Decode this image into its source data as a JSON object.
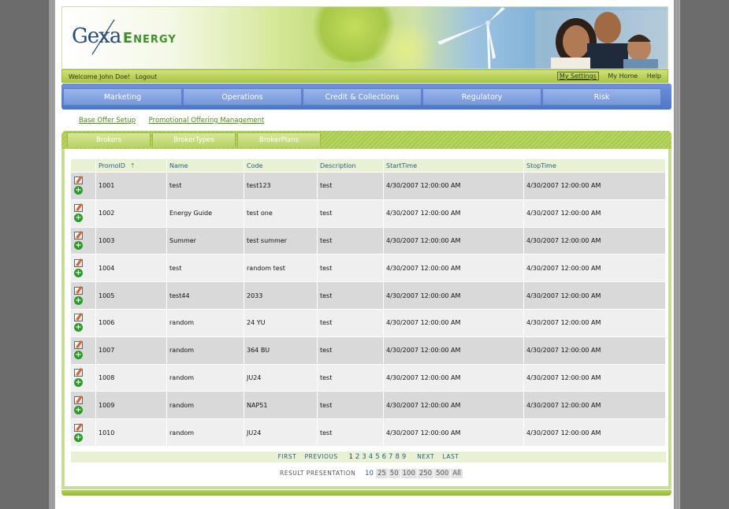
{
  "brand": {
    "name_part1": "Gexa",
    "name_part2": "Energy"
  },
  "topbar": {
    "welcome": "Welcome John Doe!",
    "logout": "Logout",
    "links": [
      "My Settings",
      "My Home",
      "Help"
    ]
  },
  "nav": [
    "Marketing",
    "Operations",
    "Credit & Collections",
    "Regulatory",
    "Risk"
  ],
  "subnav": [
    "Base Offer Setup",
    "Promotional Offering Management"
  ],
  "tabs": [
    "Brokers",
    "BrokerTypes",
    "BrokerPlans"
  ],
  "table": {
    "headers": [
      "PromoID",
      "Name",
      "Code",
      "Description",
      "StartTime",
      "StopTime"
    ],
    "rows": [
      [
        "1001",
        "test",
        "test123",
        "test",
        "4/30/2007 12:00:00 AM",
        "4/30/2007 12:00:00 AM"
      ],
      [
        "1002",
        "Energy Guide",
        "test one",
        "test",
        "4/30/2007 12:00:00 AM",
        "4/30/2007 12:00:00 AM"
      ],
      [
        "1003",
        "Summer",
        "test summer",
        "test",
        "4/30/2007 12:00:00 AM",
        "4/30/2007 12:00:00 AM"
      ],
      [
        "1004",
        "test",
        "random test",
        "test",
        "4/30/2007 12:00:00 AM",
        "4/30/2007 12:00:00 AM"
      ],
      [
        "1005",
        "test44",
        "2033",
        "test",
        "4/30/2007 12:00:00 AM",
        "4/30/2007 12:00:00 AM"
      ],
      [
        "1006",
        "random",
        "24 YU",
        "test",
        "4/30/2007 12:00:00 AM",
        "4/30/2007 12:00:00 AM"
      ],
      [
        "1007",
        "random",
        "364 BU",
        "test",
        "4/30/2007 12:00:00 AM",
        "4/30/2007 12:00:00 AM"
      ],
      [
        "1008",
        "random",
        "JU24",
        "test",
        "4/30/2007 12:00:00 AM",
        "4/30/2007 12:00:00 AM"
      ],
      [
        "1009",
        "random",
        "NAP51",
        "test",
        "4/30/2007 12:00:00 AM",
        "4/30/2007 12:00:00 AM"
      ],
      [
        "1010",
        "random",
        "JU24",
        "test",
        "4/30/2007 12:00:00 AM",
        "4/30/2007 12:00:00 AM"
      ]
    ]
  },
  "pager": {
    "first": "FIRST",
    "previous": "PREVIOUS",
    "next": "NEXT",
    "last": "LAST",
    "pages": [
      "1",
      "2",
      "3",
      "4",
      "5",
      "6",
      "7",
      "8",
      "9"
    ],
    "current_page": "1"
  },
  "result_presentation": {
    "label": "RESULT PRESENTATION",
    "options": [
      "10",
      "25",
      "50",
      "100",
      "250",
      "500",
      "All"
    ],
    "current": "10"
  },
  "colors": {
    "nav_blue": "#5a7fcc",
    "accent_green": "#a8c84e",
    "link_green": "#4e8a1a",
    "header_text_blue": "#2a5d8a"
  }
}
